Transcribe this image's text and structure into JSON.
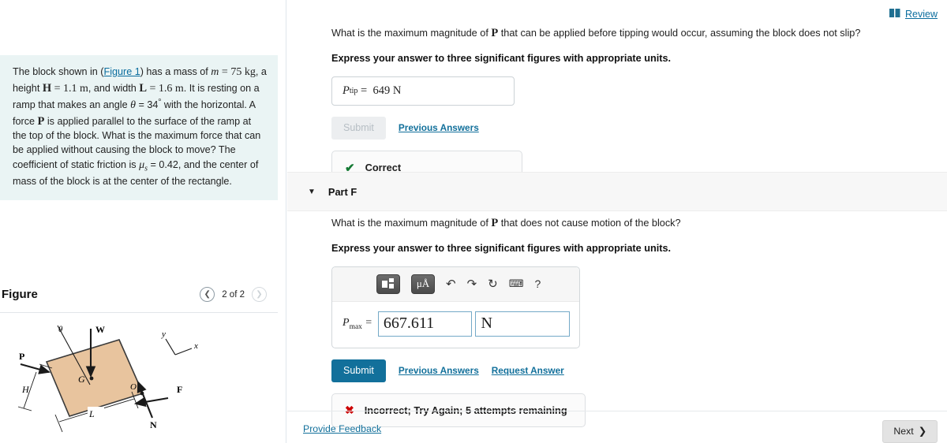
{
  "left": {
    "problem": {
      "pre": "The block shown in (",
      "figure_link": "Figure 1",
      "line1_after": ") has a mass of ",
      "mass_sym": "m",
      "mass_val": "= 75 kg",
      "h_text": ", a height ",
      "H_sym": "H",
      "H_val": "= 1.1 m",
      "and_width": ", and width ",
      "L_sym": "L",
      "L_val": "= 1.6 m",
      "resting": ". It is resting on a ramp that makes an angle ",
      "theta_sym": "θ",
      "theta_val": "= 34",
      "deg": "°",
      "force_text": " with the horizontal. A force ",
      "P_sym": "P",
      "applied": " is applied parallel to the surface of the ramp at the top of the block. What is the maximum force that can be applied without causing the block to move? The coefficient of static friction is ",
      "mu_sym": "μ",
      "mu_sub": "s",
      "mu_val": " = 0.42, and the center of mass of the block is at the center of the rectangle."
    },
    "figure": {
      "title": "Figure",
      "page_label": "2 of 2",
      "prev_icon": "chevron-left-icon",
      "next_icon": "chevron-right-icon",
      "labels": {
        "P": "P",
        "W": "W",
        "F": "F",
        "N": "N",
        "G": "G",
        "O": "O",
        "H": "H",
        "L": "L",
        "theta": "θ",
        "x": "x",
        "y": "y"
      },
      "block_color": "#e8c49e",
      "block_stroke": "#3a3a3a"
    }
  },
  "header": {
    "review_label": "Review",
    "review_icon": "book-icon"
  },
  "partE": {
    "question": "What is the maximum magnitude of ",
    "question_var": "P",
    "question_tail": " that can be applied before tipping would occur, assuming the block does not slip?",
    "instruction": "Express your answer to three significant figures with appropriate units.",
    "answer_label": "P",
    "answer_sub": "tip",
    "answer_eq": "=",
    "answer_value": "649 N",
    "submit_label": "Submit",
    "previous_answers_label": "Previous Answers",
    "status_icon": "check-icon",
    "status_text": "Correct"
  },
  "partF": {
    "caret_icon": "caret-down-icon",
    "title": "Part F",
    "question": "What is the maximum magnitude of ",
    "question_var": "P",
    "question_tail": " that does not cause motion of the block?",
    "instruction": "Express your answer to three significant figures with appropriate units.",
    "toolbar": [
      {
        "name": "template-icon",
        "glyph": ""
      },
      {
        "name": "units-icon",
        "glyph": "μÅ"
      },
      {
        "name": "undo-icon",
        "glyph": "↶"
      },
      {
        "name": "redo-icon",
        "glyph": "↷"
      },
      {
        "name": "reset-icon",
        "glyph": "↻"
      },
      {
        "name": "keyboard-icon",
        "glyph": "⌨"
      },
      {
        "name": "help-icon",
        "glyph": "?"
      }
    ],
    "answer_label": "P",
    "answer_sub": "max",
    "answer_eq": "=",
    "answer_value": "667.611",
    "answer_unit": "N",
    "submit_label": "Submit",
    "previous_answers_label": "Previous Answers",
    "request_answer_label": "Request Answer",
    "status_icon": "cross-icon",
    "status_text": "Incorrect; Try Again; 5 attempts remaining"
  },
  "footer": {
    "provide_feedback": "Provide Feedback",
    "next_label": "Next",
    "next_icon": "chevron-right-icon"
  },
  "colors": {
    "accent": "#12709b",
    "link": "#0b6d9e",
    "correct": "#157a34",
    "incorrect": "#cc0000",
    "problem_bg": "#eaf4f4"
  }
}
